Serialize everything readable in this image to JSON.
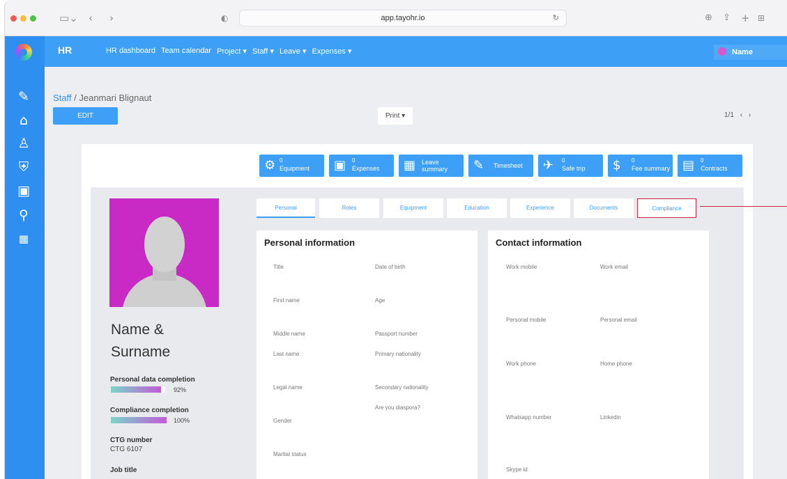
{
  "browser": {
    "url": "app.tayohr.io"
  },
  "app": {
    "section": "HR",
    "nav": [
      "HR dashboard",
      "Team calendar",
      "Project ▾",
      "Staff ▾",
      "Leave ▾",
      "Expenses ▾"
    ],
    "user": "Name"
  },
  "page": {
    "breadcrumb_root": "Staff",
    "breadcrumb_sep": " / ",
    "breadcrumb_current": "Jeanmari Blignaut",
    "edit": "EDIT",
    "print": "Print ▾",
    "pager": "1/1",
    "prev": "‹",
    "next": "›"
  },
  "quick": [
    {
      "count": "0",
      "label": "Equipment",
      "icon": "equipment-icon"
    },
    {
      "count": "0",
      "label": "Expenses",
      "icon": "expenses-icon"
    },
    {
      "count": "",
      "label": "Leave summary",
      "icon": "calendar-icon"
    },
    {
      "count": "",
      "label": "Timesheet",
      "icon": "timesheet-icon"
    },
    {
      "count": "0",
      "label": "Safe trip",
      "icon": "plane-icon"
    },
    {
      "count": "0",
      "label": "Fee summary",
      "icon": "dollar-icon"
    },
    {
      "count": "0",
      "label": "Contracts",
      "icon": "contracts-icon"
    }
  ],
  "profile": {
    "name_line1": "Name &",
    "name_line2": "Surname",
    "personal_completion_label": "Personal data completion",
    "personal_completion": "92%",
    "personal_completion_fraction": 0.92,
    "compliance_label": "Compliance completion",
    "compliance": "100%",
    "compliance_fraction": 1.0,
    "ctg_label": "CTG number",
    "ctg": "CTG 6107",
    "job_label": "Job title"
  },
  "tabs": [
    "Personal",
    "Roles",
    "Equipment",
    "Education",
    "Experience",
    "Documents",
    "Compliance"
  ],
  "personal": {
    "title": "Personal information",
    "fields": [
      "Title",
      "Date of birth",
      "First name",
      "Age",
      "Middle name",
      "Passport number",
      "Last name",
      "Primary nationality",
      "Legal name",
      "Secondary nationality",
      "Are you diaspora?",
      "Gender",
      "Marital status"
    ]
  },
  "contact": {
    "title": "Contact information",
    "fields": [
      "Work mobile",
      "Work email",
      "Personal mobile",
      "Personal email",
      "Work phone",
      "Home phone",
      "Whatsapp number",
      "Linkedin",
      "Skype id"
    ]
  },
  "colors": {
    "primary": "#3d9ff5",
    "sidebar": "#2f8ff0",
    "highlight": "#c8243e",
    "photo_bg": "#c92ac6"
  }
}
